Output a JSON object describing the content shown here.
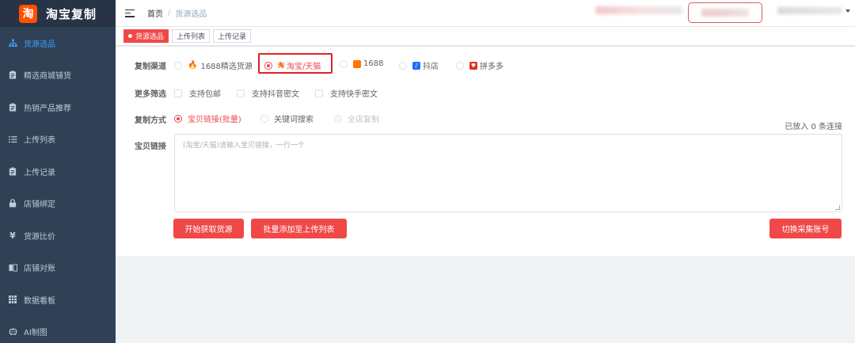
{
  "app": {
    "logo_char": "淘",
    "title": "淘宝复制"
  },
  "sidebar": {
    "items": [
      {
        "label": "货源选品",
        "icon": "sitemap-icon",
        "active": true
      },
      {
        "label": "精选商城铺货",
        "icon": "clipboard-icon"
      },
      {
        "label": "热销产品推荐",
        "icon": "clipboard-icon"
      },
      {
        "label": "上传列表",
        "icon": "list-icon"
      },
      {
        "label": "上传记录",
        "icon": "clipboard-icon"
      },
      {
        "label": "店铺绑定",
        "icon": "lock-icon"
      },
      {
        "label": "货源比价",
        "icon": "yen-icon"
      },
      {
        "label": "店铺对账",
        "icon": "book-icon"
      },
      {
        "label": "数据看板",
        "icon": "table-icon"
      },
      {
        "label": "AI制图",
        "icon": "robot-icon"
      }
    ]
  },
  "breadcrumb": {
    "home": "首页",
    "sep": "/",
    "current": "货源选品"
  },
  "tags": [
    {
      "label": "货源选品",
      "active": true
    },
    {
      "label": "上传列表"
    },
    {
      "label": "上传记录"
    }
  ],
  "form": {
    "channel": {
      "label": "复制渠道",
      "options": [
        "1688精选货源",
        "淘宝/天猫",
        "1688",
        "抖店",
        "拼多多"
      ],
      "selected": "淘宝/天猫"
    },
    "filters": {
      "label": "更多筛选",
      "options": [
        "支持包邮",
        "支持抖音密文",
        "支持快手密文"
      ]
    },
    "method": {
      "label": "复制方式",
      "options": [
        "宝贝链接(批量)",
        "关键词搜索",
        "全店复制"
      ],
      "selected": "宝贝链接(批量)"
    },
    "links": {
      "label": "宝贝链接",
      "placeholder": "(淘宝/天猫)请输入宝贝链接，一行一个",
      "value": ""
    },
    "counter": "已放入 0 条连接"
  },
  "buttons": {
    "start": "开始获取货源",
    "batch_add": "批量添加至上传列表",
    "switch_account": "切换采集账号"
  },
  "colors": {
    "accent": "#f04848",
    "sidebar_bg": "#304156",
    "sidebar_active": "#409eff"
  }
}
